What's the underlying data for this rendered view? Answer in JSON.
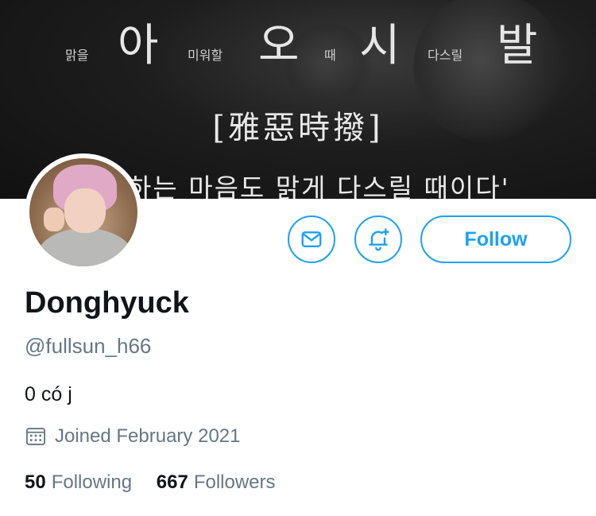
{
  "banner": {
    "top_words": [
      {
        "text": "맑을",
        "size": "sm"
      },
      {
        "text": "아",
        "size": "big"
      },
      {
        "text": "미워할",
        "size": "sm"
      },
      {
        "text": "오",
        "size": "big"
      },
      {
        "text": "때",
        "size": "sm"
      },
      {
        "text": "시",
        "size": "big"
      },
      {
        "text": "다스릴",
        "size": "sm"
      },
      {
        "text": "발",
        "size": "big"
      }
    ],
    "hanja": "[雅惡時撥]",
    "quote": "하는 마음도 맑게 다스릴 때이다'"
  },
  "profile": {
    "display_name": "Donghyuck",
    "handle": "@fullsun_h66",
    "bio": "0 có j",
    "joined": "Joined February 2021",
    "following_count": "50",
    "following_label": "Following",
    "followers_count": "667",
    "followers_label": "Followers"
  },
  "actions": {
    "message_icon": "envelope-icon",
    "notify_icon": "bell-plus-icon",
    "follow_label": "Follow"
  },
  "colors": {
    "accent": "#1da1f2",
    "text_primary": "#0f1419",
    "text_secondary": "#657786"
  }
}
